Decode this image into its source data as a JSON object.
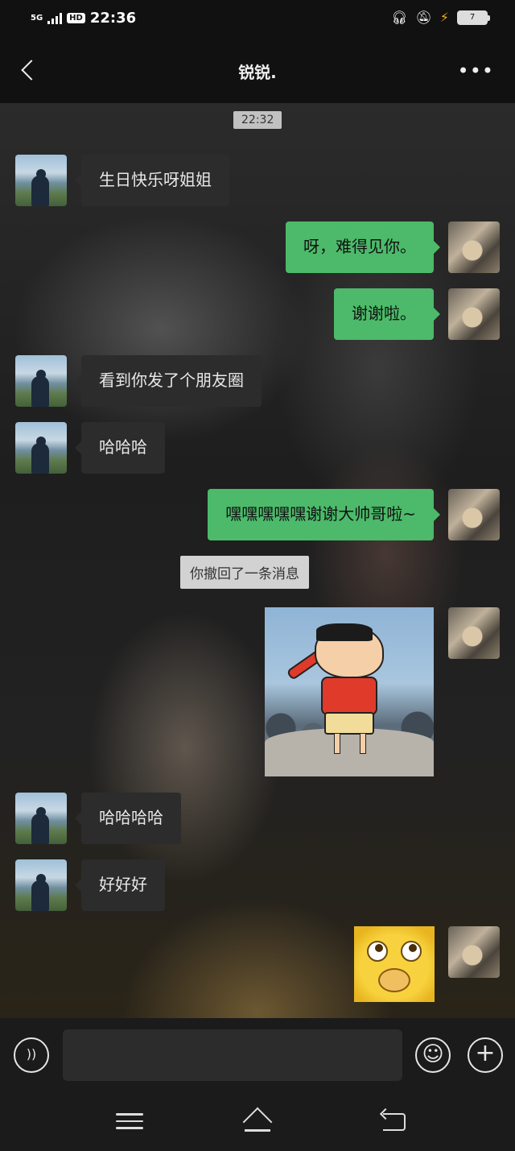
{
  "status_bar": {
    "network": "5G",
    "hd_badge": "HD",
    "time": "22:36",
    "battery_level": "7"
  },
  "header": {
    "title": "锐锐."
  },
  "chat": {
    "timestamp": "22:32",
    "recall_notice": "你撤回了一条消息",
    "messages": [
      {
        "from": "friend",
        "text": "生日快乐呀姐姐"
      },
      {
        "from": "me",
        "text": "呀，难得见你。"
      },
      {
        "from": "me",
        "text": "谢谢啦。"
      },
      {
        "from": "friend",
        "text": "看到你发了个朋友圈"
      },
      {
        "from": "friend",
        "text": "哈哈哈"
      },
      {
        "from": "me",
        "text": "嘿嘿嘿嘿嘿谢谢大帅哥啦~"
      },
      {
        "from": "me",
        "sticker": "crayon-shin-chan-sticker"
      },
      {
        "from": "friend",
        "text": "哈哈哈哈"
      },
      {
        "from": "friend",
        "text": "好好好"
      },
      {
        "from": "me",
        "sticker": "drooling-emoji-sticker"
      }
    ]
  },
  "input_bar": {
    "text_value": "",
    "voice_icon": "voice-icon",
    "emoji_icon": "emoji-icon",
    "plus_icon": "plus-icon"
  },
  "colors": {
    "my_bubble": "#4cba6a",
    "friend_bubble": "#2c2c2c",
    "background": "#111111"
  }
}
